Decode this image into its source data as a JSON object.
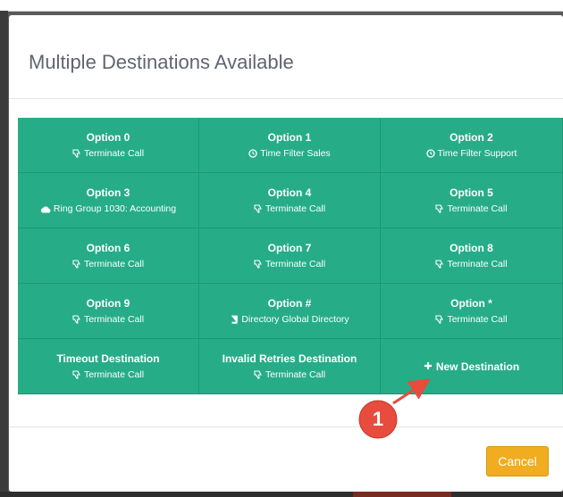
{
  "dialog": {
    "title": "Multiple Destinations Available"
  },
  "options": [
    {
      "title": "Option 0",
      "icon": "thumbs-down-icon",
      "subtitle": "Terminate Call"
    },
    {
      "title": "Option 1",
      "icon": "clock-icon",
      "subtitle": "Time Filter Sales"
    },
    {
      "title": "Option 2",
      "icon": "clock-icon",
      "subtitle": "Time Filter Support"
    },
    {
      "title": "Option 3",
      "icon": "cloud-icon",
      "subtitle": "Ring Group 1030: Accounting"
    },
    {
      "title": "Option 4",
      "icon": "thumbs-down-icon",
      "subtitle": "Terminate Call"
    },
    {
      "title": "Option 5",
      "icon": "thumbs-down-icon",
      "subtitle": "Terminate Call"
    },
    {
      "title": "Option 6",
      "icon": "thumbs-down-icon",
      "subtitle": "Terminate Call"
    },
    {
      "title": "Option 7",
      "icon": "thumbs-down-icon",
      "subtitle": "Terminate Call"
    },
    {
      "title": "Option 8",
      "icon": "thumbs-down-icon",
      "subtitle": "Terminate Call"
    },
    {
      "title": "Option 9",
      "icon": "thumbs-down-icon",
      "subtitle": "Terminate Call"
    },
    {
      "title": "Option #",
      "icon": "book-icon",
      "subtitle": "Directory Global Directory"
    },
    {
      "title": "Option *",
      "icon": "thumbs-down-icon",
      "subtitle": "Terminate Call"
    },
    {
      "title": "Timeout Destination",
      "icon": "thumbs-down-icon",
      "subtitle": "Terminate Call"
    },
    {
      "title": "Invalid Retries Destination",
      "icon": "thumbs-down-icon",
      "subtitle": "Terminate Call"
    }
  ],
  "new_destination": {
    "label": "New Destination",
    "icon": "plus-icon"
  },
  "footer": {
    "cancel_label": "Cancel"
  },
  "annotation": {
    "step_number": "1"
  },
  "colors": {
    "option_bg": "#26ad88",
    "cancel_bg": "#f0ad1f",
    "callout_red": "#e74c3c"
  }
}
